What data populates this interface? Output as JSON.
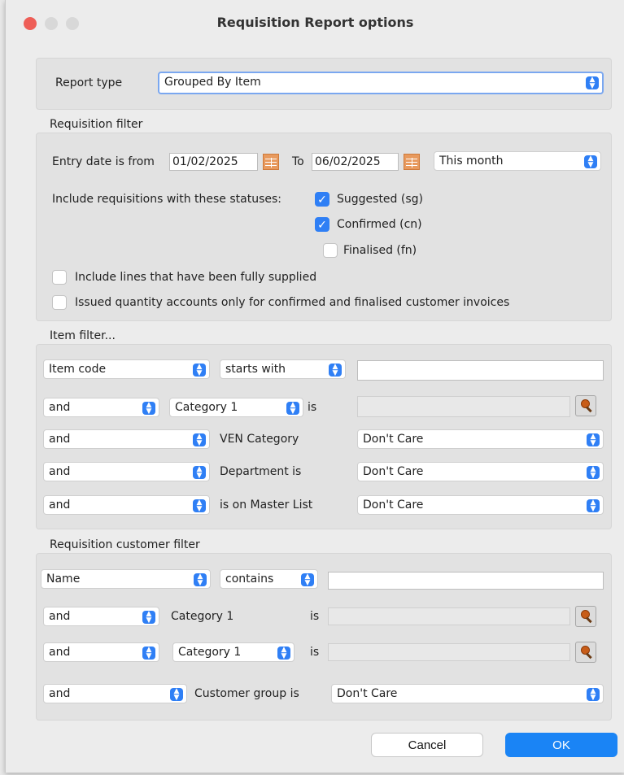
{
  "window": {
    "title": "Requisition Report options"
  },
  "report_type": {
    "label": "Report type",
    "value": "Grouped By Item"
  },
  "requisition_filter": {
    "title": "Requisition filter",
    "entry_date_label": "Entry date is from",
    "from_date": "01/02/2025",
    "to_label": "To",
    "to_date": "06/02/2025",
    "period": "This month",
    "statuses_label": "Include requisitions with these statuses:",
    "statuses": [
      {
        "label": "Suggested (sg)",
        "checked": true
      },
      {
        "label": "Confirmed (cn)",
        "checked": true
      },
      {
        "label": "Finalised (fn)",
        "checked": false
      }
    ],
    "include_fully_supplied": {
      "label": "Include lines that have been fully supplied",
      "checked": false
    },
    "issued_confirmed_only": {
      "label": "Issued quantity accounts only for confirmed and finalised customer invoices",
      "checked": false
    }
  },
  "item_filter": {
    "title": "Item filter...",
    "row1": {
      "field": "Item code",
      "operator": "starts with",
      "value": ""
    },
    "row2": {
      "conj": "and",
      "field": "Category 1",
      "is": "is"
    },
    "row3": {
      "conj": "and",
      "label": "VEN Category",
      "value": "Don't Care"
    },
    "row4": {
      "conj": "and",
      "label": "Department is",
      "value": "Don't Care"
    },
    "row5": {
      "conj": "and",
      "label": "is on Master List",
      "value": "Don't Care"
    }
  },
  "customer_filter": {
    "title": "Requisition customer filter",
    "row1": {
      "field": "Name",
      "operator": "contains",
      "value": ""
    },
    "row2": {
      "conj": "and",
      "label": "Category 1",
      "is": "is"
    },
    "row3": {
      "conj": "and",
      "field": "Category 1",
      "is": "is"
    },
    "row4": {
      "conj": "and",
      "label": "Customer group is",
      "value": "Don't Care"
    }
  },
  "buttons": {
    "cancel": "Cancel",
    "ok": "OK"
  }
}
